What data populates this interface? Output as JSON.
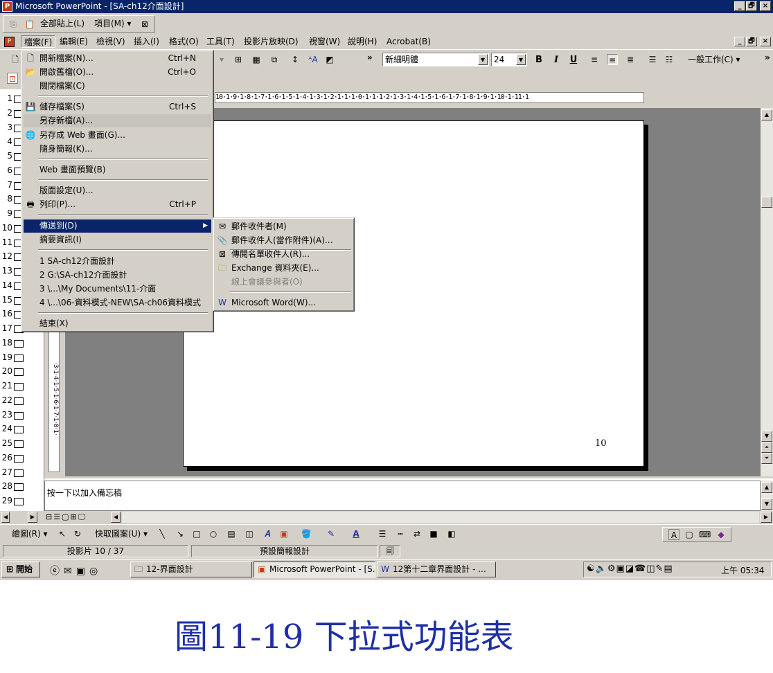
{
  "window": {
    "title": "Microsoft PowerPoint - [SA-ch12介面設計]",
    "app_icon": "P",
    "controls": [
      "_",
      "🗗",
      "×"
    ]
  },
  "clipboard_toolbar": {
    "paste_all": "全部貼上(L)",
    "items": "項目(M) ▾"
  },
  "menubar": {
    "items": [
      "檔案(F)",
      "編輯(E)",
      "檢視(V)",
      "插入(I)",
      "格式(O)",
      "工具(T)",
      "投影片放映(D)",
      "視窗(W)",
      "說明(H)",
      "Acrobat(B)"
    ],
    "doc_controls": [
      "_",
      "🗗",
      "×"
    ]
  },
  "formatting": {
    "font": "新細明體",
    "size": "24",
    "bold": "B",
    "italic": "I",
    "underline": "U",
    "common_tasks": "一般工作(C) ▾"
  },
  "ruler": {
    "text": "10·1·9·1·8·1·7·1·6·1·5·1·4·1·3·1·2·1·1·1·0·1·1·1·2·1·3·1·4·1·5·1·6·1·7·1·8·1·9·1·10·1·11·1"
  },
  "file_menu": {
    "items": [
      {
        "label": "開新檔案(N)...",
        "shortcut": "Ctrl+N",
        "icon": "new-file-icon"
      },
      {
        "label": "開啟舊檔(O)...",
        "shortcut": "Ctrl+O",
        "icon": "open-folder-icon"
      },
      {
        "label": "關閉檔案(C)",
        "shortcut": "",
        "icon": ""
      },
      {
        "label": "儲存檔案(S)",
        "shortcut": "Ctrl+S",
        "icon": "save-disk-icon"
      },
      {
        "label": "另存新檔(A)...",
        "shortcut": "",
        "icon": ""
      },
      {
        "label": "另存成 Web 畫面(G)...",
        "shortcut": "",
        "icon": "web-save-icon"
      },
      {
        "label": "隨身簡報(K)...",
        "shortcut": "",
        "icon": ""
      },
      {
        "label": "Web 畫面預覽(B)",
        "shortcut": "",
        "icon": ""
      },
      {
        "label": "版面設定(U)...",
        "shortcut": "",
        "icon": ""
      },
      {
        "label": "列印(P)...",
        "shortcut": "Ctrl+P",
        "icon": "printer-icon"
      },
      {
        "label": "傳送到(D)",
        "shortcut": "",
        "icon": ""
      },
      {
        "label": "摘要資訊(I)",
        "shortcut": "",
        "icon": ""
      },
      {
        "label": "1 SA-ch12介面設計",
        "shortcut": "",
        "icon": ""
      },
      {
        "label": "2 G:\\SA-ch12介面設計",
        "shortcut": "",
        "icon": ""
      },
      {
        "label": "3 \\...\\My Documents\\11-介面",
        "shortcut": "",
        "icon": ""
      },
      {
        "label": "4 \\...\\06-資料模式-NEW\\SA-ch06資料模式",
        "shortcut": "",
        "icon": ""
      },
      {
        "label": "結束(X)",
        "shortcut": "",
        "icon": ""
      }
    ]
  },
  "send_to_menu": {
    "items": [
      {
        "label": "郵件收件者(M)",
        "icon": "mail-recipient-icon",
        "disabled": false
      },
      {
        "label": "郵件收件人(當作附件)(A)...",
        "icon": "mail-attachment-icon",
        "disabled": false
      },
      {
        "label": "傳閱名單收件人(R)...",
        "icon": "routing-slip-icon",
        "disabled": false
      },
      {
        "label": "Exchange 資料夾(E)...",
        "icon": "exchange-folder-icon",
        "disabled": false
      },
      {
        "label": "線上會議參與者(O)",
        "icon": "",
        "disabled": true
      },
      {
        "label": "Microsoft Word(W)...",
        "icon": "word-icon",
        "disabled": false
      }
    ]
  },
  "outline": {
    "numbers": [
      "1",
      "2",
      "3",
      "4",
      "5",
      "6",
      "7",
      "8",
      "9",
      "10",
      "11",
      "12",
      "13",
      "14",
      "15",
      "16",
      "17",
      "18",
      "19",
      "20",
      "21",
      "22",
      "23",
      "24",
      "25",
      "26",
      "27",
      "28",
      "29"
    ]
  },
  "slide": {
    "page_number": "10"
  },
  "notes": {
    "placeholder": "按一下以加入備忘稿"
  },
  "drawing_toolbar": {
    "draw": "繪圖(R) ▾",
    "autoshapes": "快取圖案(U) ▾"
  },
  "statusbar": {
    "slide": "投影片 10 / 37",
    "design": "預設簡報設計"
  },
  "taskbar": {
    "start": "開始",
    "buttons": [
      "12-界面設計",
      "Microsoft PowerPoint - [S...",
      "12第十二章界面設計 - ..."
    ],
    "clock": "上午 05:34"
  },
  "caption": "圖11-19 下拉式功能表",
  "colors": {
    "titlebar": "#0a246a",
    "chrome": "#d4d0c8",
    "highlight": "#0a246a",
    "caption": "#1f2fa6",
    "workspace": "#808080"
  }
}
